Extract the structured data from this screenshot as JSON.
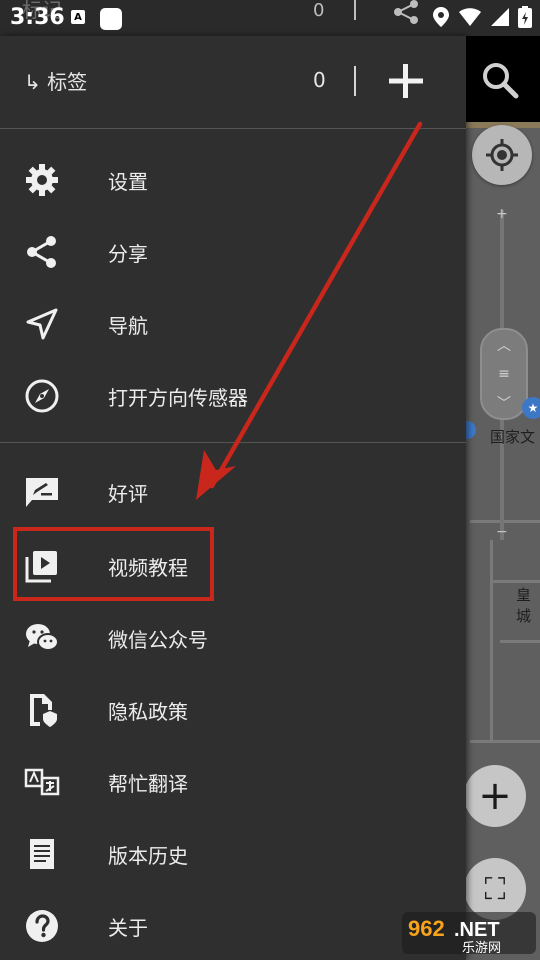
{
  "status_bar": {
    "time": "3:36",
    "ghost_title": "标记",
    "a_badge": "A",
    "ghost_count": "0"
  },
  "drawer": {
    "header": {
      "title": "↳ 标签",
      "count": "0"
    },
    "groups": [
      [
        {
          "label": "设置",
          "icon": "gear-icon"
        },
        {
          "label": "分享",
          "icon": "share-icon"
        },
        {
          "label": "导航",
          "icon": "navigation-icon"
        },
        {
          "label": "打开方向传感器",
          "icon": "compass-icon"
        }
      ],
      [
        {
          "label": "好评",
          "icon": "rate-icon"
        },
        {
          "label": "视频教程",
          "icon": "video-library-icon"
        },
        {
          "label": "微信公众号",
          "icon": "wechat-icon"
        },
        {
          "label": "隐私政策",
          "icon": "privacy-icon"
        },
        {
          "label": "帮忙翻译",
          "icon": "translate-icon"
        },
        {
          "label": "版本历史",
          "icon": "document-icon"
        },
        {
          "label": "关于",
          "icon": "help-icon"
        }
      ]
    ]
  },
  "map": {
    "zoom_plus": "+",
    "zoom_minus": "−",
    "poi_1": "国家文",
    "poi_2": "皇城"
  },
  "annotation": {
    "highlight_color": "#c9261c",
    "arrow_color": "#c9261c"
  },
  "watermark": {
    "brand": "962.NET",
    "subtitle": "乐游网"
  }
}
